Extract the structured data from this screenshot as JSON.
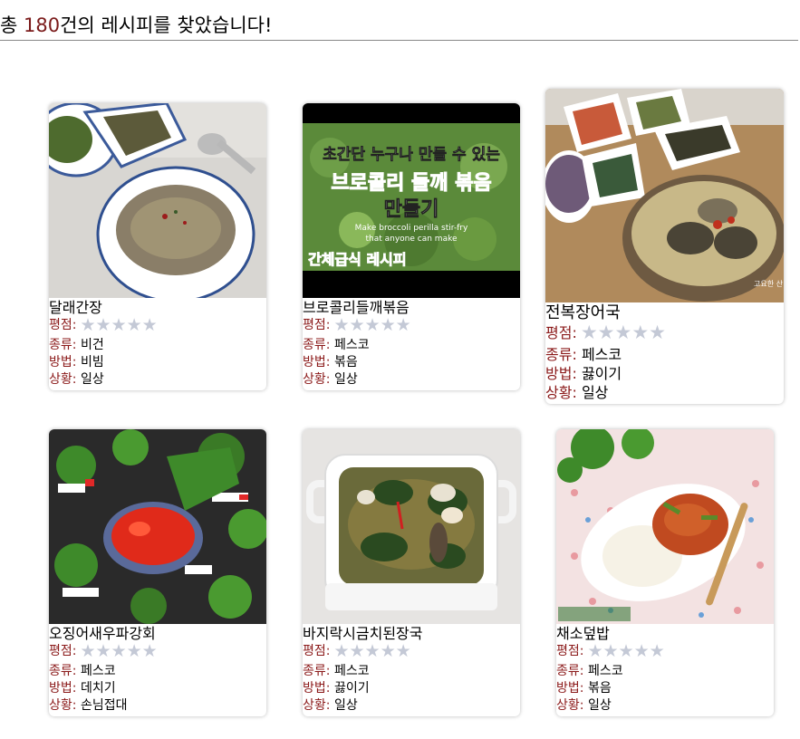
{
  "header": {
    "prefix": "총 ",
    "count": "180",
    "suffix": "건의 레시피를 찾았습니다!"
  },
  "ui": {
    "rating_label": "평점",
    "type_label": "종류",
    "method_label": "방법",
    "occasion_label": "상황",
    "colon": ": ",
    "stars": "★★★★★"
  },
  "recipes": [
    {
      "title": "달래간장",
      "rating": 0,
      "type": "비건",
      "method": "비빔",
      "occasion": "일상",
      "thumb_alt": "Bowl of rice with seasoning and side dishes"
    },
    {
      "title": "브로콜리들깨볶음",
      "rating": 0,
      "type": "페스코",
      "method": "볶음",
      "occasion": "일상",
      "thumb_alt": "Video thumbnail",
      "thumb_text": {
        "line1": "초간단 누구나 만들 수 있는",
        "line2": "브로콜리 들깨 볶음",
        "line3": "만들기",
        "line4": "Make broccoli perilla stir-fry",
        "line5": "that anyone can make",
        "line6": "간체급식 레시피"
      }
    },
    {
      "title": "전복장어국",
      "rating": 0,
      "type": "페스코",
      "method": "끓이기",
      "occasion": "일상",
      "thumb_alt": "Abalone soup with banchan",
      "watermark": "고요한 산"
    },
    {
      "title": "오징어새우파강회",
      "rating": 0,
      "type": "페스코",
      "method": "데치기",
      "occasion": "손님접대",
      "thumb_alt": "Green onion rolls with red sauce"
    },
    {
      "title": "바지락시금치된장국",
      "rating": 0,
      "type": "페스코",
      "method": "끓이기",
      "occasion": "일상",
      "thumb_alt": "Clam spinach doenjang soup"
    },
    {
      "title": "채소덮밥",
      "rating": 0,
      "type": "페스코",
      "method": "볶음",
      "occasion": "일상",
      "thumb_alt": "Vegetable rice bowl"
    }
  ],
  "colors": {
    "label": "#8b1a1a",
    "count": "#7a1a1a",
    "star_empty": "#c4c9d6"
  }
}
